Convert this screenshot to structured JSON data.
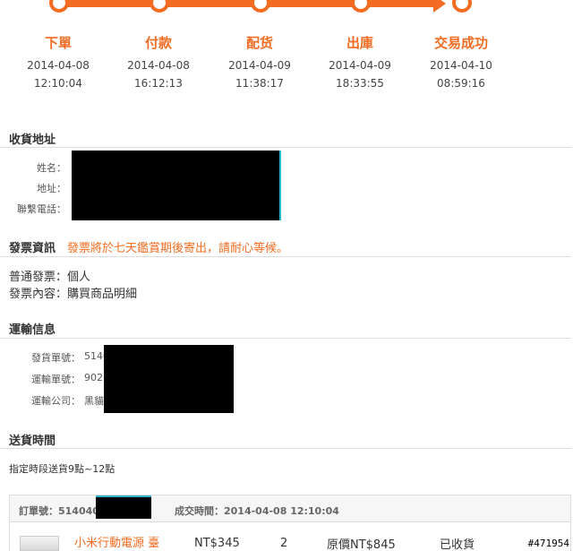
{
  "progress": {
    "steps": [
      {
        "label": "下單",
        "date": "2014-04-08",
        "time": "12:10:04"
      },
      {
        "label": "付款",
        "date": "2014-04-08",
        "time": "16:12:13"
      },
      {
        "label": "配货",
        "date": "2014-04-09",
        "time": "11:38:17"
      },
      {
        "label": "出庫",
        "date": "2014-04-09",
        "time": "18:33:55"
      },
      {
        "label": "交易成功",
        "date": "2014-04-10",
        "time": "08:59:16"
      }
    ]
  },
  "address": {
    "title": "收貨地址",
    "name_label": "姓名：",
    "addr_label": "地址：",
    "phone_label": "聯繫電話："
  },
  "invoice": {
    "title": "發票資訊",
    "notice": "發票將於七天鑑賞期後寄出，請耐心等候。",
    "type": "普通發票：個人",
    "content": "發票內容：購買商品明細"
  },
  "shipping": {
    "title": "運輸信息",
    "ship_no_label": "發貨單號：",
    "ship_no_value": "5140",
    "track_no_label": "運輸單號：",
    "track_no_value": "9027",
    "carrier_label": "運輸公司：",
    "carrier_value": "黑貓"
  },
  "delivery": {
    "title": "送貨時間",
    "text": "指定時段送貨9點~12點"
  },
  "order": {
    "order_no": "訂單號：514040",
    "deal_time": "成交時間：2014-04-08 12:10:04",
    "product_name": "小米行動電源 臺",
    "price": "NT$345",
    "qty": "2",
    "original": "原價NT$845",
    "status": "已收貨"
  },
  "watermark": "#471954",
  "colors": {
    "accent": "#f26c22"
  }
}
